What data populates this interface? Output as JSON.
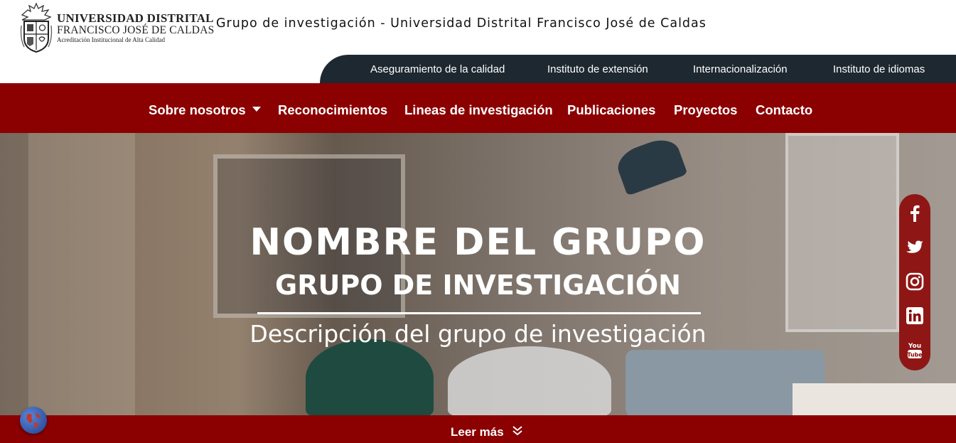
{
  "header": {
    "logo": {
      "line1": "UNIVERSIDAD DISTRITAL",
      "line2": "FRANCISCO JOSÉ DE CALDAS",
      "line3": "Acreditación Institucional de Alta Calidad"
    },
    "site_title": "Grupo de investigación - Universidad Distrital Francisco José de Caldas",
    "top_links": [
      "Aseguramiento de la calidad",
      "Instituto de extensión",
      "Internacionalización",
      "Instituto de idiomas"
    ]
  },
  "nav": {
    "items": [
      "Sobre nosotros",
      "Reconocimientos",
      "Lineas de investigación",
      "Publicaciones",
      "Proyectos",
      "Contacto"
    ]
  },
  "hero": {
    "title": "NOMBRE DEL GRUPO",
    "subtitle": "GRUPO DE INVESTIGACIÓN",
    "description": "Descripción del grupo de investigación"
  },
  "social": {
    "icons": [
      "facebook-icon",
      "twitter-icon",
      "instagram-icon",
      "linkedin-icon",
      "youtube-icon"
    ],
    "youtube_line1": "You",
    "youtube_line2": "Tube"
  },
  "footer": {
    "read_more": "Leer más"
  },
  "colors": {
    "brand_red": "#8b0000",
    "dark_bar": "#1e2831"
  }
}
